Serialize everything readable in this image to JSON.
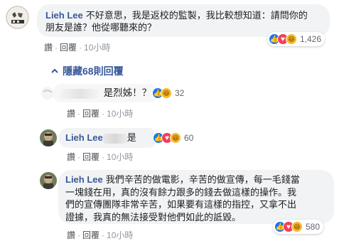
{
  "comments": [
    {
      "author": "Lieh Lee",
      "text_line1": "不好意思，我是返校的監製，我比較想知道：請問你的",
      "text_line2": "朋友是誰？他從哪聽來的？",
      "reaction_count": "1,426",
      "actions": {
        "reply": "讚",
        "reply2": "回覆",
        "time": "10小時"
      },
      "avatar_label": "返校"
    },
    {
      "author": "",
      "text": "是烈姊！？",
      "reaction_count": "32",
      "actions": {
        "reply": "讚",
        "reply2": "回覆",
        "time": "10小時"
      }
    },
    {
      "author": "Lieh Lee",
      "text": "是",
      "reaction_count": "60",
      "actions": {
        "reply": "讚",
        "reply2": "回覆",
        "time": "10小時"
      }
    },
    {
      "author": "Lieh Lee",
      "text_line1": "我們辛苦的做電影，辛苦的做宣傳，每一毛錢當",
      "text_line2": "一塊錢在用，真的沒有餘力跟多的錢去做這樣的操作。我",
      "text_line3": "們的宣傳團隊非常辛苦，如果要有這樣的指控，又拿不出",
      "text_line4": "證據，我真的無法接受對他們如此的詆毀。",
      "reaction_count": "580",
      "actions": {
        "reply": "讚",
        "reply2": "回覆",
        "time": "10小時"
      }
    }
  ],
  "hidden_replies": "隱藏68則回覆",
  "colors": {
    "link": "#385898",
    "bubble": "#f2f3f5",
    "like": "#1877f2",
    "love": "#f33e58",
    "haha": "#f7b928"
  },
  "icons": [
    "like-icon",
    "love-icon",
    "haha-icon",
    "chevron-up-icon"
  ]
}
